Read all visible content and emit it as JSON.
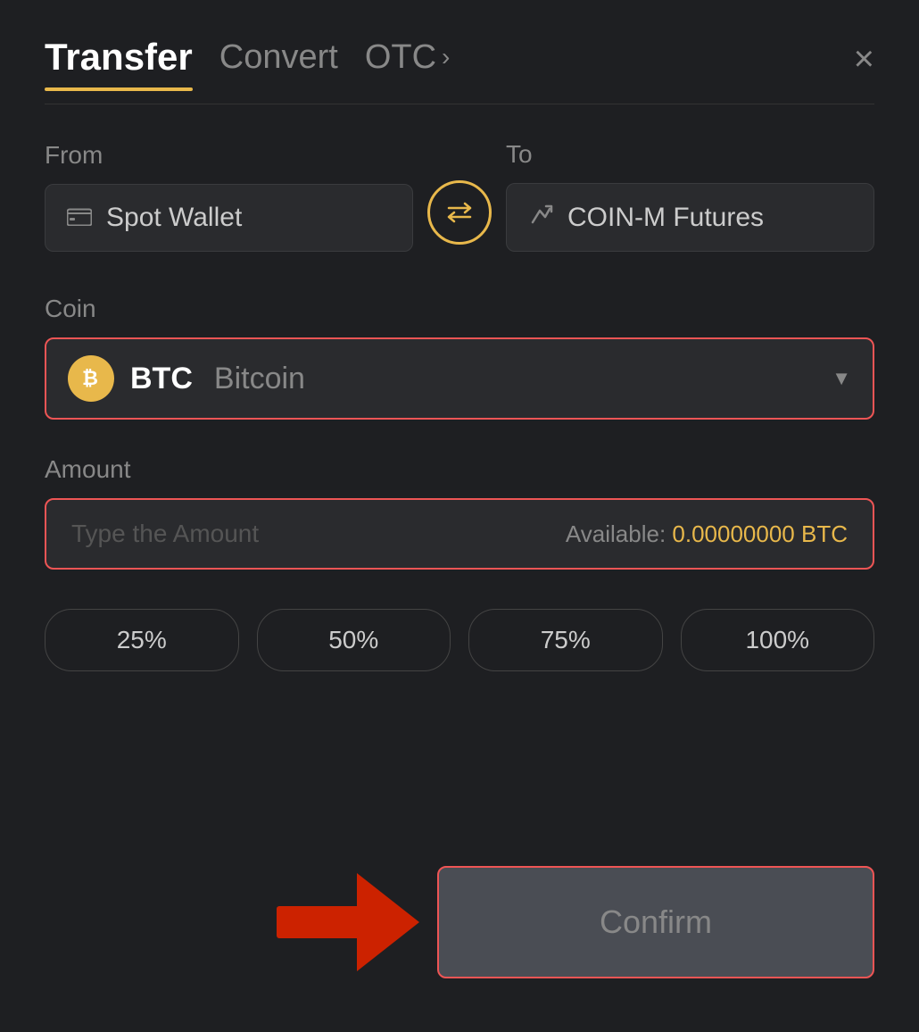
{
  "header": {
    "tab_transfer": "Transfer",
    "tab_convert": "Convert",
    "tab_otc": "OTC",
    "otc_chevron": "›",
    "close_label": "×"
  },
  "from_section": {
    "label": "From",
    "wallet_label": "Spot Wallet"
  },
  "to_section": {
    "label": "To",
    "wallet_label": "COIN-M Futures"
  },
  "coin_section": {
    "label": "Coin",
    "coin_symbol": "BTC",
    "coin_name": "Bitcoin",
    "btc_symbol": "₿"
  },
  "amount_section": {
    "label": "Amount",
    "placeholder": "Type the Amount",
    "available_label": "Available:",
    "available_value": "0.00000000 BTC"
  },
  "percent_buttons": {
    "btn25": "25%",
    "btn50": "50%",
    "btn75": "75%",
    "btn100": "100%"
  },
  "confirm_button": {
    "label": "Confirm"
  }
}
